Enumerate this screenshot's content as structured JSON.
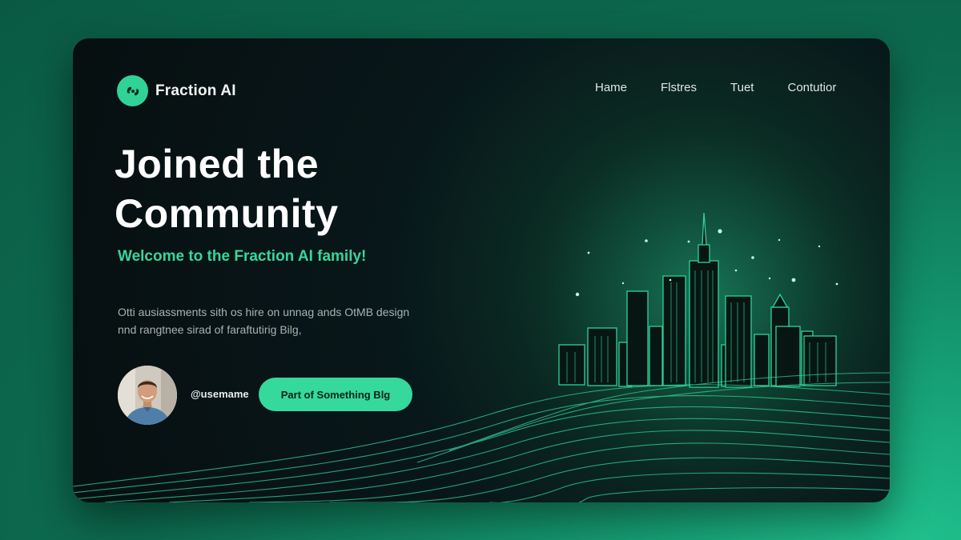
{
  "brand": {
    "name": "Fraction AI",
    "accent": "#35d99b",
    "icon": "hands-logo-icon"
  },
  "nav": {
    "items": [
      "Hame",
      "Flstres",
      "Tuet",
      "Contutior"
    ]
  },
  "hero": {
    "headline_line1": "Joined the",
    "headline_line2": "Community",
    "subhead": "Welcome to the Fraction AI family!",
    "body_line1": "Otti ausiassments sith os hire on unnag ands OtMB design",
    "body_line2": "nnd rangtnee sirad of faraftutirig Bilg,"
  },
  "profile": {
    "username": "@usemame",
    "avatar": "user-avatar-photo"
  },
  "cta": {
    "label": "Part of Something Blg"
  },
  "illustration": {
    "subject": "city-skyline-with-wave-lines",
    "colors": {
      "glow": "#1c8c66",
      "lines": "#2fd396"
    }
  }
}
